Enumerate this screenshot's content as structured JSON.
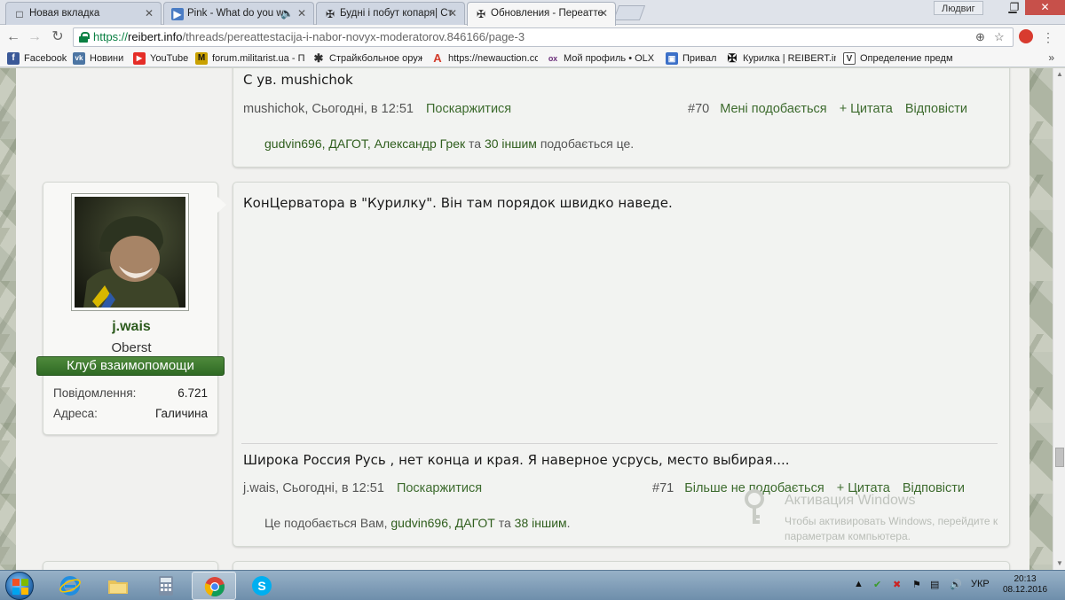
{
  "browser": {
    "tabs": [
      {
        "title": "Новая вкладка",
        "active": false
      },
      {
        "title": "Pink - What do you w",
        "active": false,
        "audio": true
      },
      {
        "title": "Будні і побут копаря| Ст",
        "active": false
      },
      {
        "title": "Обновления - Переатте",
        "active": true
      }
    ],
    "user_chip": "Людвиг",
    "url_scheme": "https://",
    "url_host": "reibert.info",
    "url_path": "/threads/pereattestacija-i-nabor-novyx-moderatorov.846166/page-3",
    "bookmarks": [
      {
        "label": "Facebook",
        "icon": "facebook-icon",
        "color": "#3b5998",
        "glyph": "f"
      },
      {
        "label": "Новини",
        "icon": "vk-icon",
        "color": "#4c75a3",
        "glyph": "vk"
      },
      {
        "label": "YouTube",
        "icon": "youtube-icon",
        "color": "#e52d27",
        "glyph": "▶"
      },
      {
        "label": "forum.militarist.ua - П",
        "icon": "militarist-icon",
        "color": "#c9a100",
        "glyph": "M"
      },
      {
        "label": "Страйкбольное оруж",
        "icon": "airsoft-icon",
        "color": "#333333",
        "glyph": "✱"
      },
      {
        "label": "https://newauction.co",
        "icon": "newauction-icon",
        "color": "#d23a2a",
        "glyph": "A"
      },
      {
        "label": "Мой профиль • OLX.",
        "icon": "olx-icon",
        "color": "#6b2f7a",
        "glyph": "ох"
      },
      {
        "label": "Привал",
        "icon": "privat-icon",
        "color": "#3c70c8",
        "glyph": "▣"
      },
      {
        "label": "Курилка | REIBERT.inf",
        "icon": "reibert-icon",
        "color": "#111111",
        "glyph": "✠"
      },
      {
        "label": "Определение предм",
        "icon": "v-icon",
        "color": "#555555",
        "glyph": "V"
      }
    ]
  },
  "post70": {
    "text": "С ув. mushichok",
    "author": "mushichok",
    "time": "Сьогодні, в 12:51",
    "report": "Поскаржитися",
    "number": "#70",
    "like": "Мені подобається",
    "quote": "+ Цитата",
    "reply": "Відповісти",
    "likes_names": "gudvin696, ДАГОТ, Александр Грек",
    "likes_and": "та",
    "likes_others": "30 іншим",
    "likes_suffix": "подобається це."
  },
  "post71": {
    "user": {
      "name": "j.wais",
      "title": "Oberst",
      "banner": "Клуб взаимопомощи",
      "stats": [
        {
          "label": "Повідомлення:",
          "value": "6.721"
        },
        {
          "label": "Адреса:",
          "value": "Галичина"
        }
      ]
    },
    "text": "КонЦерватора в \"Курилку\". Він там порядок швидко наведе.",
    "signature": "Широка Россия Русь , нет конца и края. Я наверное усрусь, место выбирая....",
    "author": "j.wais",
    "time": "Сьогодні, в 12:51",
    "report": "Поскаржитися",
    "number": "#71",
    "unlike": "Більше не подобається",
    "quote": "+ Цитата",
    "reply": "Відповісти",
    "likes_prefix": "Це подобається Вам,",
    "likes_names": "gudvin696, ДАГОТ",
    "likes_and": "та",
    "likes_others": "38 іншим",
    "likes_suffix": "."
  },
  "watermark": {
    "title": "Активация Windows",
    "line1": "Чтобы активировать Windows, перейдите к",
    "line2": "параметрам компьютера."
  },
  "taskbar": {
    "lang": "УКР",
    "time": "20:13",
    "date": "08.12.2016"
  },
  "colors": {
    "accent_green": "#3d6b2e",
    "banner_green": "#3f7a31"
  }
}
